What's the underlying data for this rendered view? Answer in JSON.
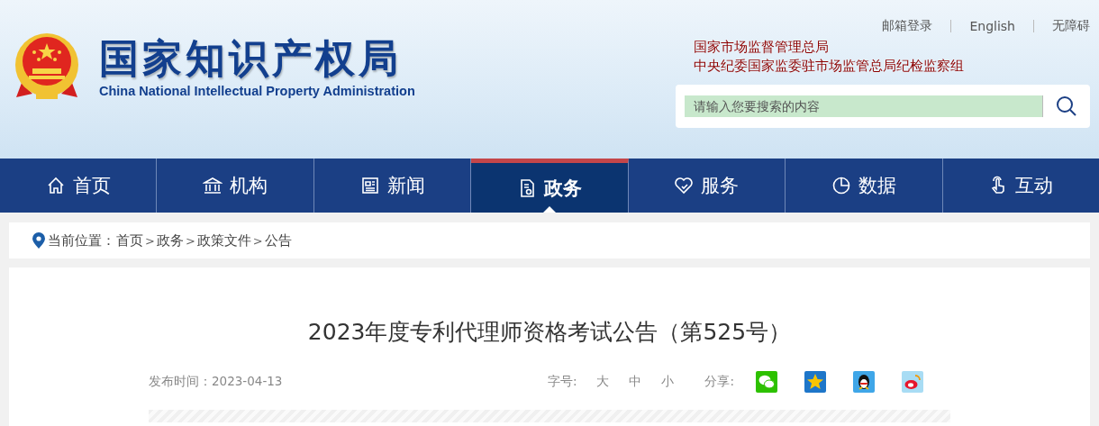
{
  "header": {
    "logo_title": "国家知识产权局",
    "logo_subtitle": "China National Intellectual Property Administration",
    "top_links": [
      "邮箱登录",
      "English",
      "无障碍"
    ],
    "affiliations": [
      "国家市场监督管理总局",
      "中央纪委国家监委驻市场监管总局纪检监察组"
    ],
    "search": {
      "placeholder": "请输入您要搜索的内容"
    }
  },
  "nav": [
    {
      "label": "首页",
      "kind": "home",
      "selected": false
    },
    {
      "label": "机构",
      "kind": "bank",
      "selected": false
    },
    {
      "label": "新闻",
      "kind": "news",
      "selected": false
    },
    {
      "label": "政务",
      "kind": "doc",
      "selected": true
    },
    {
      "label": "服务",
      "kind": "heart",
      "selected": false
    },
    {
      "label": "数据",
      "kind": "pie",
      "selected": false
    },
    {
      "label": "互动",
      "kind": "hand",
      "selected": false
    }
  ],
  "breadcrumb": {
    "label": "当前位置：",
    "items": [
      {
        "kind": "link",
        "text": "首页"
      },
      {
        "kind": "sep",
        "text": ">"
      },
      {
        "kind": "link",
        "text": "政务"
      },
      {
        "kind": "sep",
        "text": ">"
      },
      {
        "kind": "link",
        "text": "政策文件"
      },
      {
        "kind": "sep",
        "text": ">"
      },
      {
        "kind": "link",
        "text": "公告"
      }
    ]
  },
  "article": {
    "title": "2023年度专利代理师资格考试公告（第525号）",
    "published": "发布时间：2023-04-13",
    "font_size_label": "字号:",
    "font_sizes": [
      "大",
      "中",
      "小"
    ],
    "share_label": "分享:",
    "share": [
      {
        "kind": "wechat"
      },
      {
        "kind": "qzone"
      },
      {
        "kind": "qq"
      },
      {
        "kind": "weibo"
      }
    ]
  }
}
